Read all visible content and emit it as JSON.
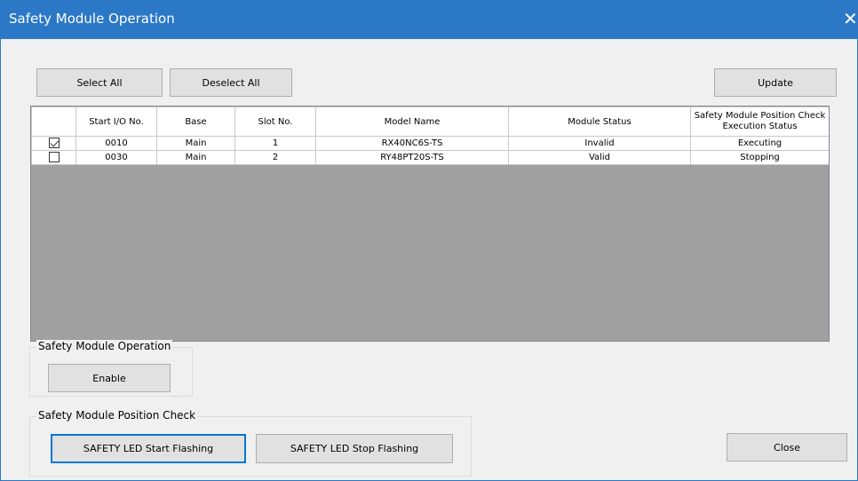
{
  "window": {
    "title": "Safety Module Operation",
    "close_glyph": "✕",
    "accent_color": "#2b78c7"
  },
  "toolbar": {
    "select_all_label": "Select All",
    "deselect_all_label": "Deselect All",
    "update_label": "Update"
  },
  "table": {
    "columns": [
      "",
      "Start I/O No.",
      "Base",
      "Slot No.",
      "Model Name",
      "Module Status",
      "Safety Module Position Check Execution Status"
    ],
    "rows": [
      {
        "checked": true,
        "start_io": "0010",
        "base": "Main",
        "slot": "1",
        "model": "RX40NC6S-TS",
        "status": "Invalid",
        "position_check": "Executing"
      },
      {
        "checked": false,
        "start_io": "0030",
        "base": "Main",
        "slot": "2",
        "model": "RY48PT20S-TS",
        "status": "Valid",
        "position_check": "Stopping"
      }
    ]
  },
  "operation_group": {
    "title": "Safety Module Operation",
    "enable_label": "Enable"
  },
  "position_group": {
    "title": "Safety Module Position Check",
    "start_label": "SAFETY LED Start Flashing",
    "stop_label": "SAFETY LED Stop Flashing"
  },
  "footer": {
    "close_label": "Close"
  }
}
